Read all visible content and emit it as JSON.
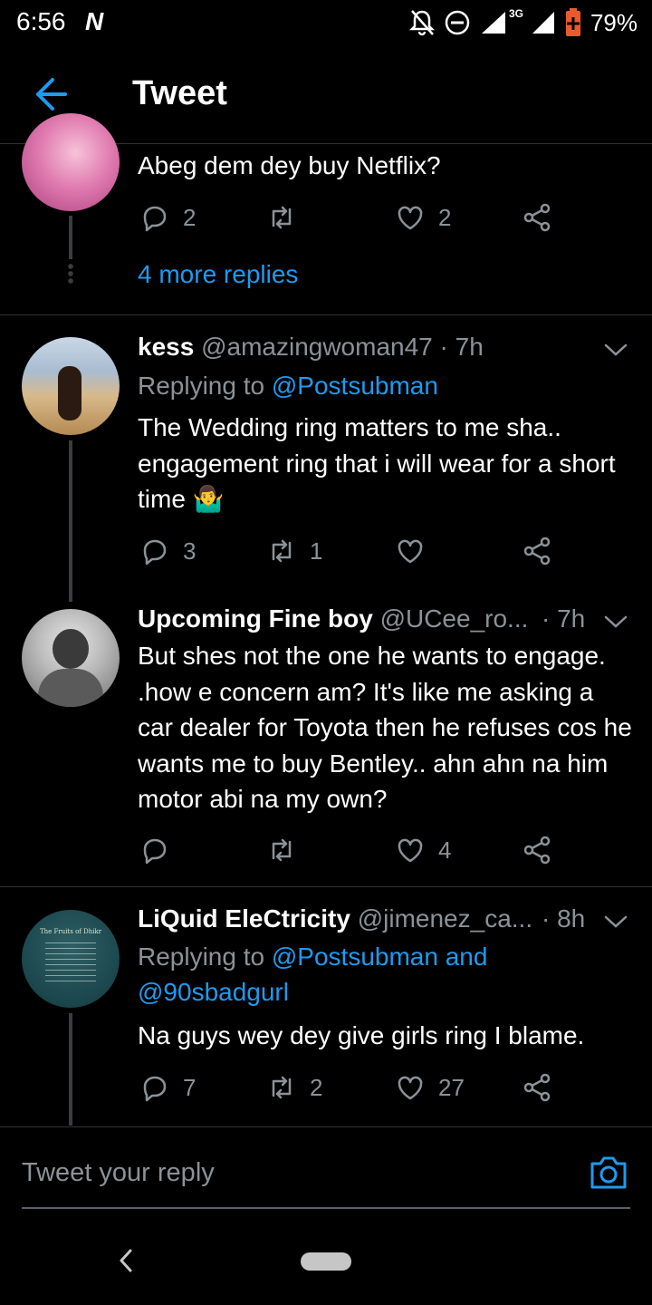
{
  "status_bar": {
    "time": "6:56",
    "carrier_icon": "N",
    "network": "3G",
    "battery": "79%"
  },
  "header": {
    "title": "Tweet"
  },
  "tweets": [
    {
      "body": "Abeg dem dey buy Netflix?",
      "replies": "2",
      "retweets": "",
      "likes": "2",
      "more_replies": "4 more replies"
    },
    {
      "name": "kess",
      "handle": "@amazingwoman47",
      "time": "· 7h",
      "replying_prefix": "Replying to",
      "replying_to": "@Postsubman",
      "body": "The Wedding ring matters to me sha.. engagement ring that i will wear for a short time 🤷‍♂️",
      "replies": "3",
      "retweets": "1",
      "likes": ""
    },
    {
      "name": "Upcoming Fine boy",
      "handle": "@UCee_ro...",
      "time": "· 7h",
      "body": "But shes not the one he wants to engage. .how e concern am? It's like me asking a car dealer for Toyota then he refuses cos he wants me to buy Bentley.. ahn ahn na him motor abi na my own?",
      "replies": "",
      "retweets": "",
      "likes": "4"
    },
    {
      "name": "LiQuid EleCtricity",
      "handle": "@jimenez_ca...",
      "time": "· 8h",
      "replying_prefix": "Replying to",
      "replying_to": "@Postsubman and",
      "replying_to_2": "@90sbadgurl",
      "body": "Na guys wey dey give girls ring I blame.",
      "replies": "7",
      "retweets": "2",
      "likes": "27",
      "avatar_title": "The Fruits of Dhikr"
    }
  ],
  "reply_bar": {
    "placeholder": "Tweet your reply"
  },
  "colors": {
    "accent": "#1d9bf0",
    "muted": "#8b9298",
    "background": "#000000"
  }
}
